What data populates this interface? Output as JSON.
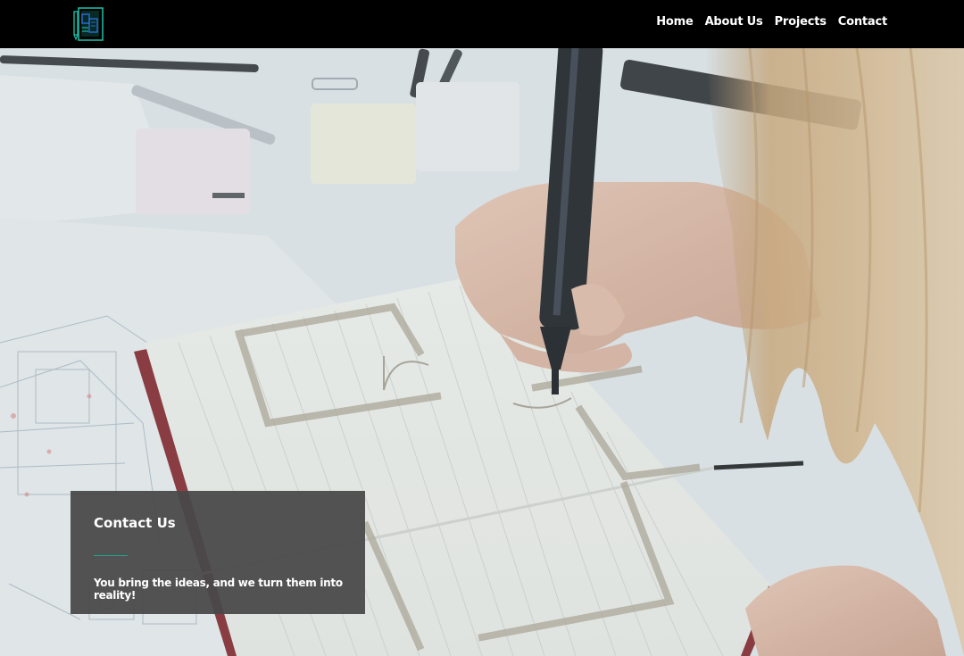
{
  "header": {
    "logo_icon": "blueprint-building-logo-icon",
    "nav": [
      {
        "label": "Home"
      },
      {
        "label": "About Us"
      },
      {
        "label": "Projects"
      },
      {
        "label": "Contact"
      }
    ]
  },
  "hero": {
    "background_icon": "architect-sketching-floor-plan-photo"
  },
  "contact": {
    "title": "Contact Us",
    "tagline": "You bring the ideas, and we turn them into reality!"
  },
  "colors": {
    "accent": "#1fa58c",
    "header_bg": "#000000",
    "card_bg": "#484848"
  }
}
